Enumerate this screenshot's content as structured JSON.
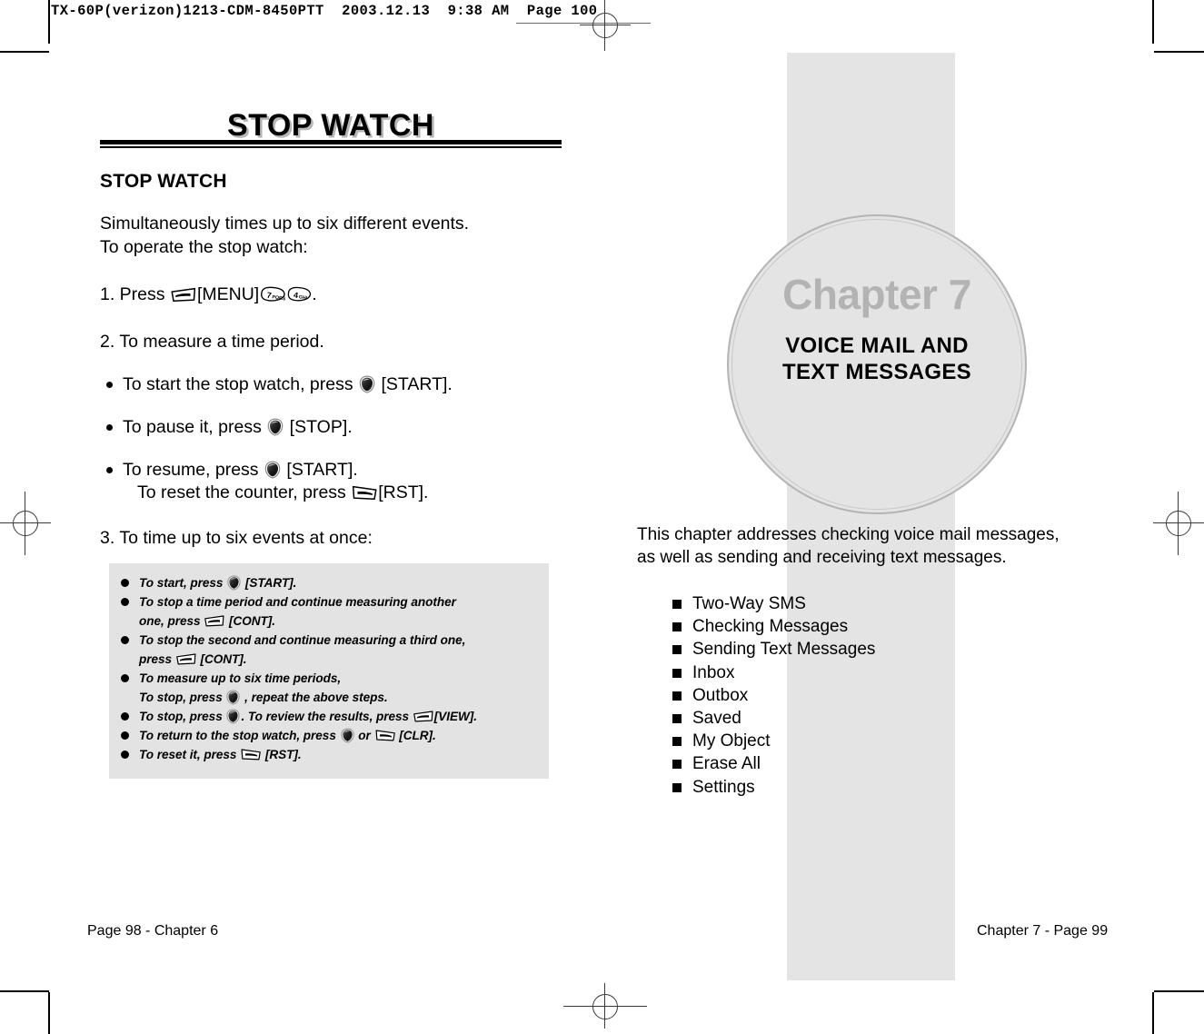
{
  "prepress": {
    "slug": "TX-60P(verizon)1213-CDM-8450PTT  2003.12.13  9:38 AM  Page 100"
  },
  "left_page": {
    "banner_title": "STOP WATCH",
    "section_heading": "STOP WATCH",
    "intro_line1": "Simultaneously times up to six different events.",
    "intro_line2": "To operate the stop watch:",
    "step1": {
      "prefix": "1. Press ",
      "menu": "[MENU]",
      "suffix": "."
    },
    "step2": "2. To measure a time period.",
    "step3": "3. To time up to six events at once:",
    "bullets": [
      {
        "pre": "To start the stop watch, press ",
        "post": " [START]."
      },
      {
        "pre": "To pause it, press ",
        "post": " [STOP]."
      },
      {
        "pre": "To resume, press ",
        "post": " [START].",
        "line2_pre": "To reset the counter, press ",
        "line2_post": "[RST]."
      }
    ],
    "note_box": [
      {
        "a": "To start, press ",
        "b": " [START]."
      },
      {
        "a": "To stop a time period and continue measuring another",
        "b2a": "one, press ",
        "b2b": " [CONT]."
      },
      {
        "a": "To stop the second and continue measuring a third one,",
        "b2a": "press ",
        "b2b": " [CONT]."
      },
      {
        "a": "To measure up to six time periods,",
        "b2a": "To stop, press ",
        "b2b": " , repeat the above steps."
      },
      {
        "a": "To stop, press ",
        "b": ". To review the results, press ",
        "c": "[VIEW]."
      },
      {
        "a": "To return to the stop watch, press ",
        "b": " or ",
        "c": " [CLR]."
      },
      {
        "a": "To reset it, press ",
        "b": " [RST]."
      }
    ],
    "footer": "Page 98 - Chapter 6"
  },
  "right_page": {
    "chapter_number": "Chapter 7",
    "chapter_title_line1": "VOICE MAIL AND",
    "chapter_title_line2": "TEXT MESSAGES",
    "intro_line1": "This chapter addresses checking voice mail messages,",
    "intro_line2": "as well as sending and receiving text messages.",
    "contents": [
      "Two-Way SMS",
      "Checking Messages",
      "Sending Text Messages",
      "Inbox",
      "Outbox",
      "Saved",
      "My Object",
      "Erase All",
      "Settings"
    ],
    "footer": "Chapter 7 - Page 99"
  },
  "icons": {
    "softkey_left": "softkey-left-icon",
    "softkey_right": "softkey-right-icon",
    "ok_key": "ok-key-icon",
    "key_7": "key-7-pqrs-icon",
    "key_4": "key-4-ghi-icon",
    "key_7_label": "7",
    "key_7_letters": "PQRS",
    "key_4_label": "4",
    "key_4_letters": "GHI"
  },
  "colors": {
    "band_gray": "#e4e4e4",
    "note_gray": "#e3e3e3",
    "chapter_num_gray": "#b3b3b3",
    "title_shadow_gray": "#b6b6b6"
  }
}
